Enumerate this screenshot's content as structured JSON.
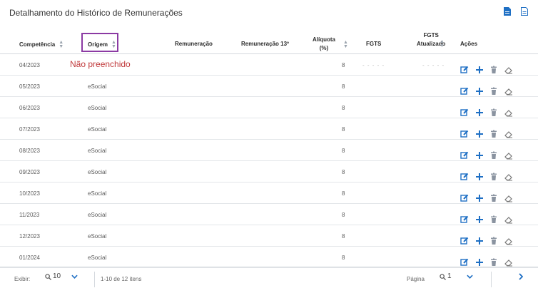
{
  "page": {
    "title": "Detalhamento do Histórico de Remunerações"
  },
  "toolbar": {
    "icons": [
      "pdf-icon",
      "document-icon"
    ],
    "accent": "#1e6fc4"
  },
  "table": {
    "columns": {
      "competencia": "Competência",
      "origem": "Origem",
      "remuneracao": "Remuneração",
      "remuneracao13": "Remuneração 13º",
      "aliquota_l1": "Alíquota",
      "aliquota_l2": "(%)",
      "fgts": "FGTS",
      "fgts_at_l1": "FGTS",
      "fgts_at_l2": "Atualizado",
      "acoes": "Ações"
    },
    "highlight_color": "#8b3aa3",
    "rows": [
      {
        "competencia": "04/2023",
        "origem": "",
        "aliquota": "8",
        "note": "Não preenchido",
        "fgts": "- - - - -",
        "fgts_atualizado": "- - - - -"
      },
      {
        "competencia": "05/2023",
        "origem": "eSocial",
        "aliquota": "8"
      },
      {
        "competencia": "06/2023",
        "origem": "eSocial",
        "aliquota": "8"
      },
      {
        "competencia": "07/2023",
        "origem": "eSocial",
        "aliquota": "8"
      },
      {
        "competencia": "08/2023",
        "origem": "eSocial",
        "aliquota": "8"
      },
      {
        "competencia": "09/2023",
        "origem": "eSocial",
        "aliquota": "8"
      },
      {
        "competencia": "10/2023",
        "origem": "eSocial",
        "aliquota": "8"
      },
      {
        "competencia": "11/2023",
        "origem": "eSocial",
        "aliquota": "8"
      },
      {
        "competencia": "12/2023",
        "origem": "eSocial",
        "aliquota": "8"
      },
      {
        "competencia": "01/2024",
        "origem": "eSocial",
        "aliquota": "8"
      }
    ],
    "action_icons": [
      "edit-icon",
      "add-icon",
      "trash-icon",
      "eraser-icon"
    ]
  },
  "footer": {
    "exibir_label": "Exibir:",
    "page_size": "10",
    "range_text": "1-10 de 12 itens",
    "pagina_label": "Página",
    "current_page": "1"
  }
}
